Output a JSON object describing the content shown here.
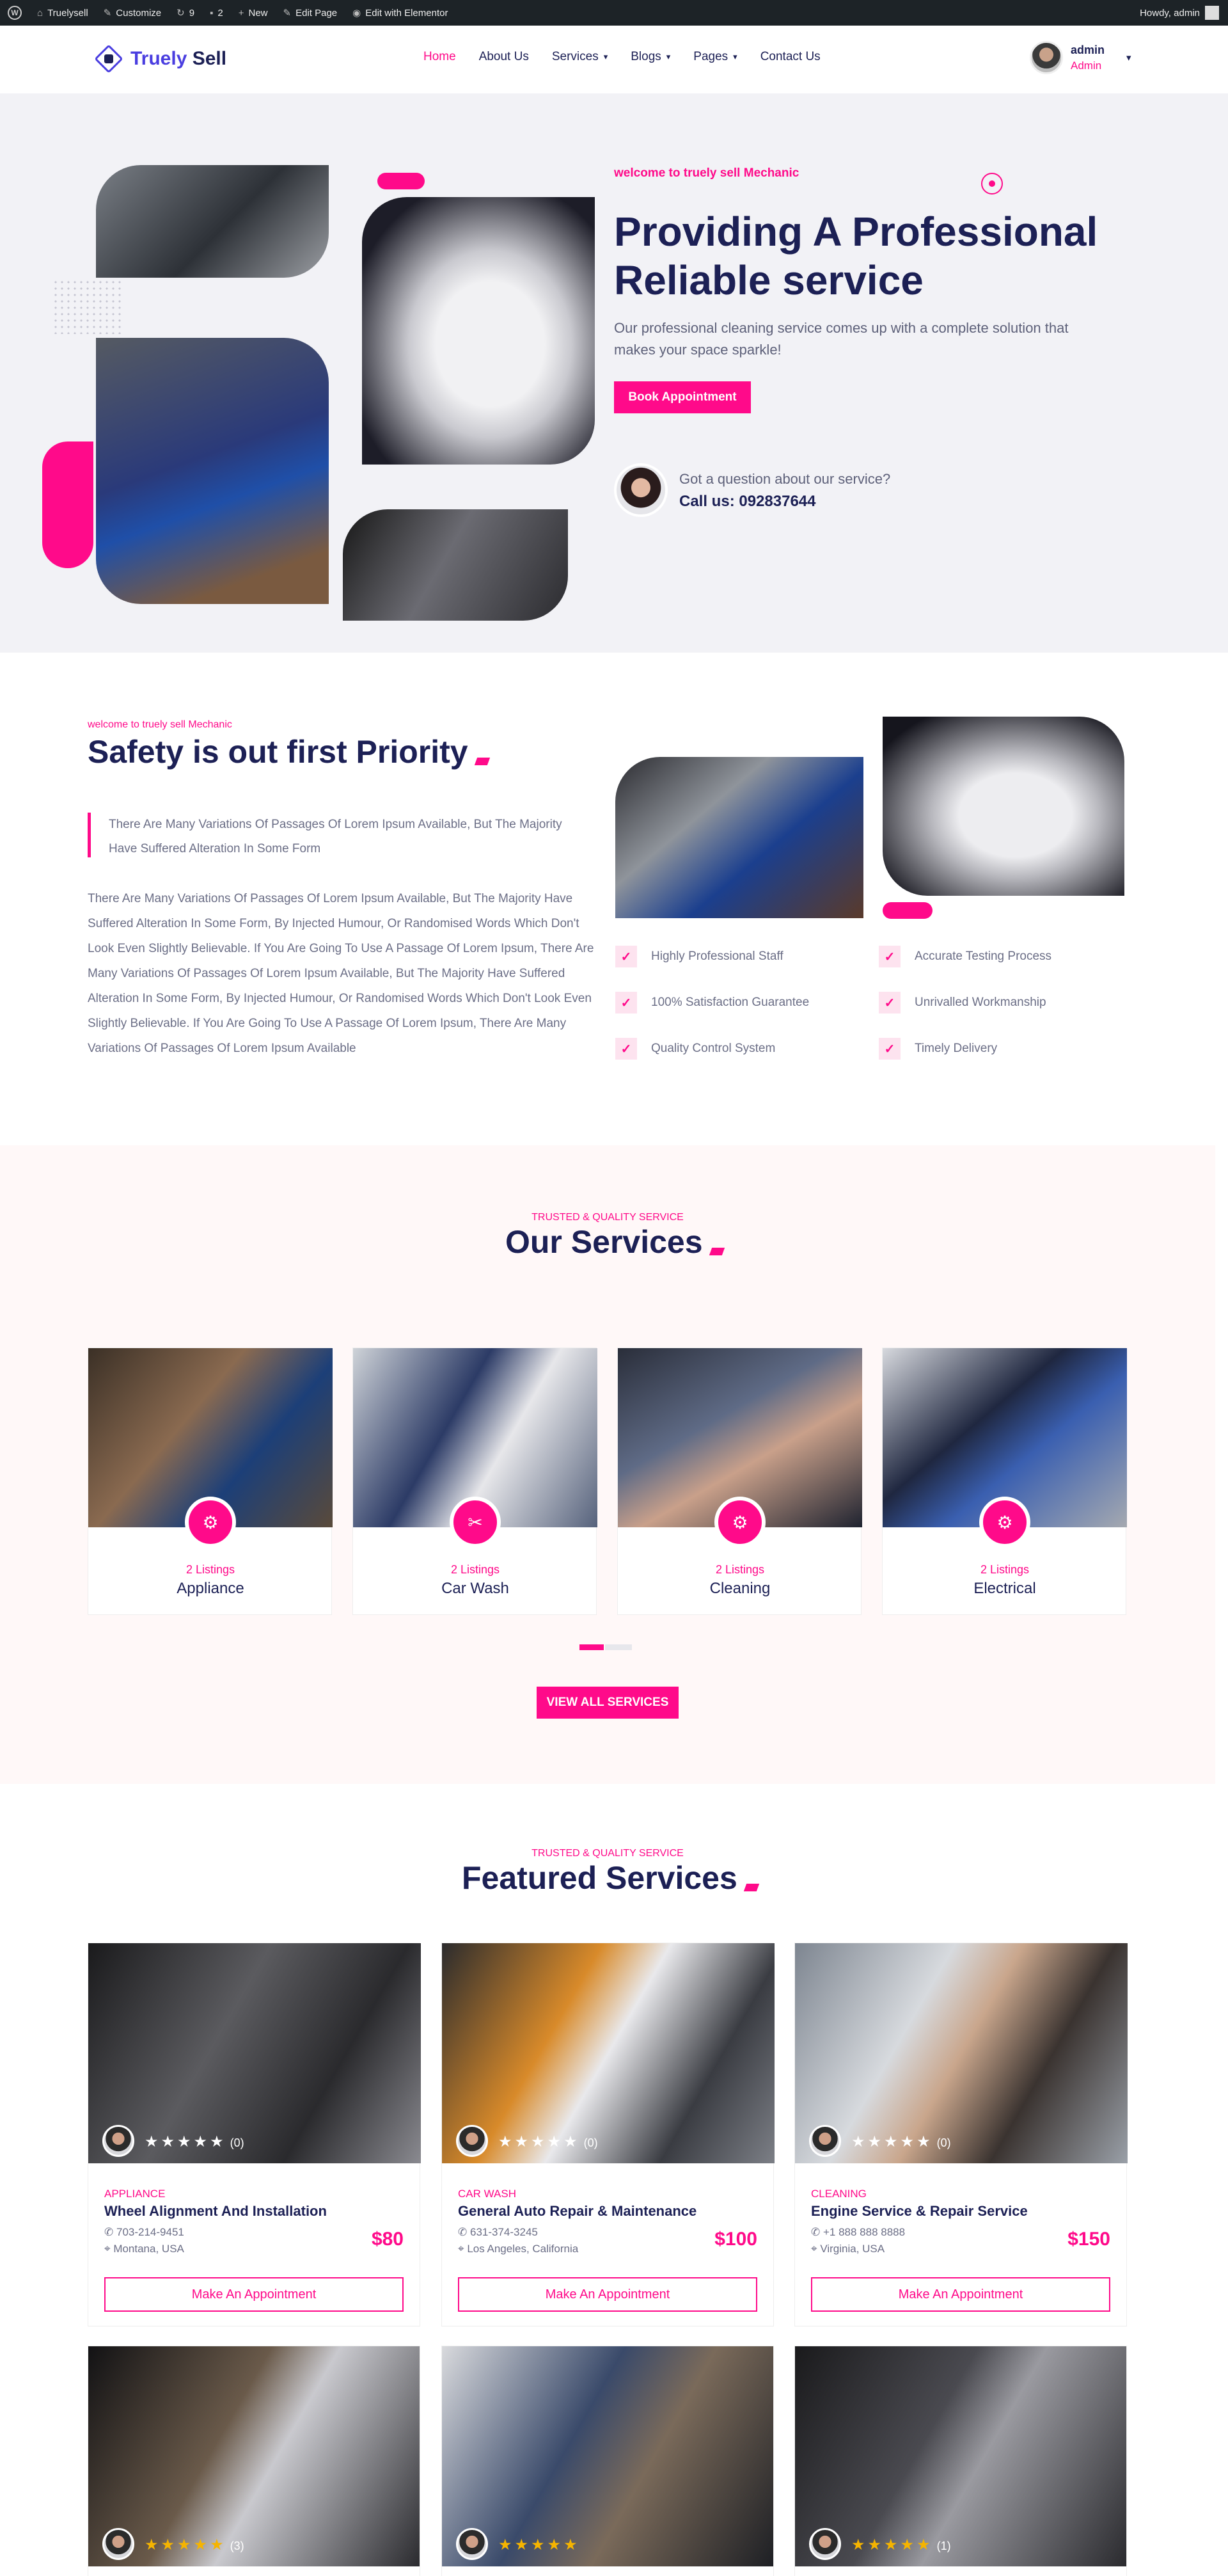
{
  "adminbar": {
    "site": "Truelysell",
    "customize": "Customize",
    "updates": "9",
    "comments": "2",
    "new": "New",
    "edit_page": "Edit Page",
    "elementor": "Edit with Elementor",
    "howdy": "Howdy, admin"
  },
  "header": {
    "logo_part1": "Truely",
    "logo_part2": "Sell",
    "nav": [
      {
        "label": "Home",
        "active": true
      },
      {
        "label": "About Us"
      },
      {
        "label": "Services",
        "dropdown": true
      },
      {
        "label": "Blogs",
        "dropdown": true
      },
      {
        "label": "Pages",
        "dropdown": true
      },
      {
        "label": "Contact Us"
      }
    ],
    "user_name": "admin",
    "user_role": "Admin"
  },
  "hero": {
    "kicker": "welcome to truely sell Mechanic",
    "title_line1": "Providing A Professional",
    "title_line2": "Reliable service",
    "description": "Our professional cleaning service comes up with a complete solution that makes your space sparkle!",
    "button": "Book Appointment",
    "question": "Got a question about our service?",
    "call": "Call us: 092837644"
  },
  "about": {
    "kicker": "welcome to truely sell Mechanic",
    "title": "Safety is out first Priority",
    "quote": "There Are Many Variations Of Passages Of Lorem Ipsum Available, But The Majority Have Suffered Alteration In Some Form",
    "body": "There Are Many Variations Of Passages Of Lorem Ipsum Available, But The Majority Have Suffered Alteration In Some Form, By Injected Humour, Or Randomised Words Which Don't Look Even Slightly Believable. If You Are Going To Use A Passage Of Lorem Ipsum, There Are Many Variations Of Passages Of Lorem Ipsum Available, But The Majority Have Suffered Alteration In Some Form, By Injected Humour, Or Randomised Words Which Don't Look Even Slightly Believable. If You Are Going To Use A Passage Of Lorem Ipsum, There Are Many Variations Of Passages Of Lorem Ipsum Available",
    "features": [
      "Highly Professional Staff",
      "Accurate Testing Process",
      "100% Satisfaction Guarantee",
      "Unrivalled Workmanship",
      "Quality Control System",
      "Timely Delivery"
    ]
  },
  "services": {
    "kicker": "TRUSTED & QUALITY SERVICE",
    "title": "Our Services",
    "items": [
      {
        "listings": "2 Listings",
        "name": "Appliance"
      },
      {
        "listings": "2 Listings",
        "name": "Car Wash"
      },
      {
        "listings": "2 Listings",
        "name": "Cleaning"
      },
      {
        "listings": "2 Listings",
        "name": "Electrical"
      }
    ],
    "button": "VIEW ALL SERVICES"
  },
  "featured": {
    "kicker": "TRUSTED & QUALITY SERVICE",
    "title": "Featured Services",
    "items": [
      {
        "category": "APPLIANCE",
        "title": "Wheel Alignment And Installation",
        "phone": "703-214-9451",
        "location": "Montana, USA",
        "price": "$80",
        "count": "(0)",
        "button": "Make An Appointment"
      },
      {
        "category": "CAR WASH",
        "title": "General Auto Repair & Maintenance",
        "phone": "631-374-3245",
        "location": "Los Angeles, California",
        "price": "$100",
        "count": "(0)",
        "button": "Make An Appointment"
      },
      {
        "category": "CLEANING",
        "title": "Engine Service & Repair Service",
        "phone": "+1 888 888 8888",
        "location": "Virginia, USA",
        "price": "$150",
        "count": "(0)",
        "button": "Make An Appointment"
      }
    ],
    "row2_counts": [
      "(3)",
      "",
      "(1)"
    ]
  },
  "colors": {
    "accent": "#ff0a8a",
    "navy": "#1c2055",
    "hero_bg": "#f2f2f6"
  }
}
